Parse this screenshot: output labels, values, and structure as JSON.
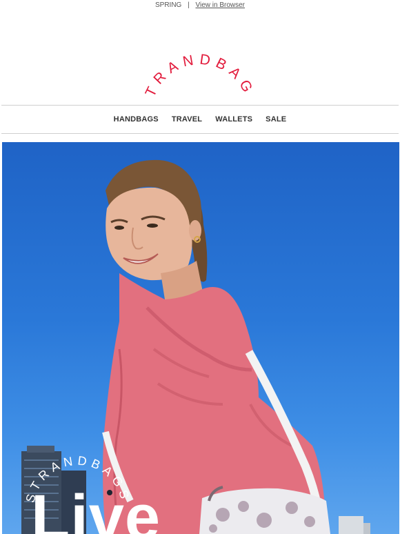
{
  "preheader": {
    "season": "SPRING",
    "separator": "|",
    "view_in_browser": "View in Browser"
  },
  "brand": {
    "logo_text": "STRANDBAGS",
    "accent_color": "#e21b3c"
  },
  "nav": {
    "items": [
      {
        "label": "HANDBAGS"
      },
      {
        "label": "TRAVEL"
      },
      {
        "label": "WALLETS"
      },
      {
        "label": "SALE"
      }
    ]
  },
  "hero": {
    "overlay_brand": "STRANDBAGS",
    "headline": "Live",
    "sky_color": "#2a78d8",
    "jacket_color": "#e2707f"
  }
}
